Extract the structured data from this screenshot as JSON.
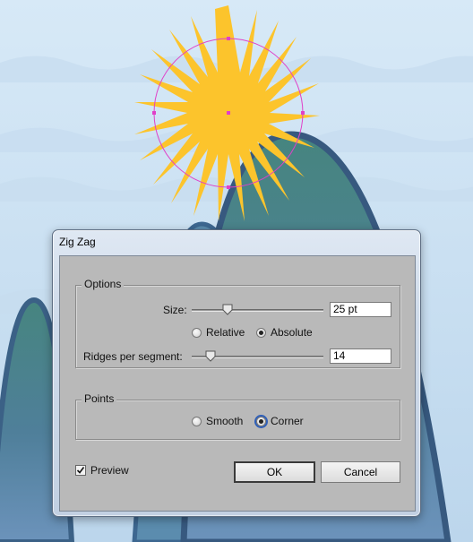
{
  "dialog": {
    "title": "Zig Zag",
    "options": {
      "legend": "Options",
      "size": {
        "label": "Size:",
        "value": "25 pt",
        "slider_fraction": 0.27
      },
      "mode": {
        "relative_label": "Relative",
        "absolute_label": "Absolute",
        "selected": "absolute"
      },
      "ridges": {
        "label": "Ridges per segment:",
        "value": "14",
        "slider_fraction": 0.14
      }
    },
    "points": {
      "legend": "Points",
      "smooth_label": "Smooth",
      "corner_label": "Corner",
      "selected": "corner"
    },
    "preview": {
      "label": "Preview",
      "checked": true
    },
    "ok_label": "OK",
    "cancel_label": "Cancel"
  },
  "colors": {
    "sky": "#cfe3f4",
    "sun": "#fcc42c",
    "selection": "#e040c8",
    "mountain": "#3f7f80",
    "mountain_outline": "#37597f",
    "dialog_panel": "#b9b9b9"
  }
}
